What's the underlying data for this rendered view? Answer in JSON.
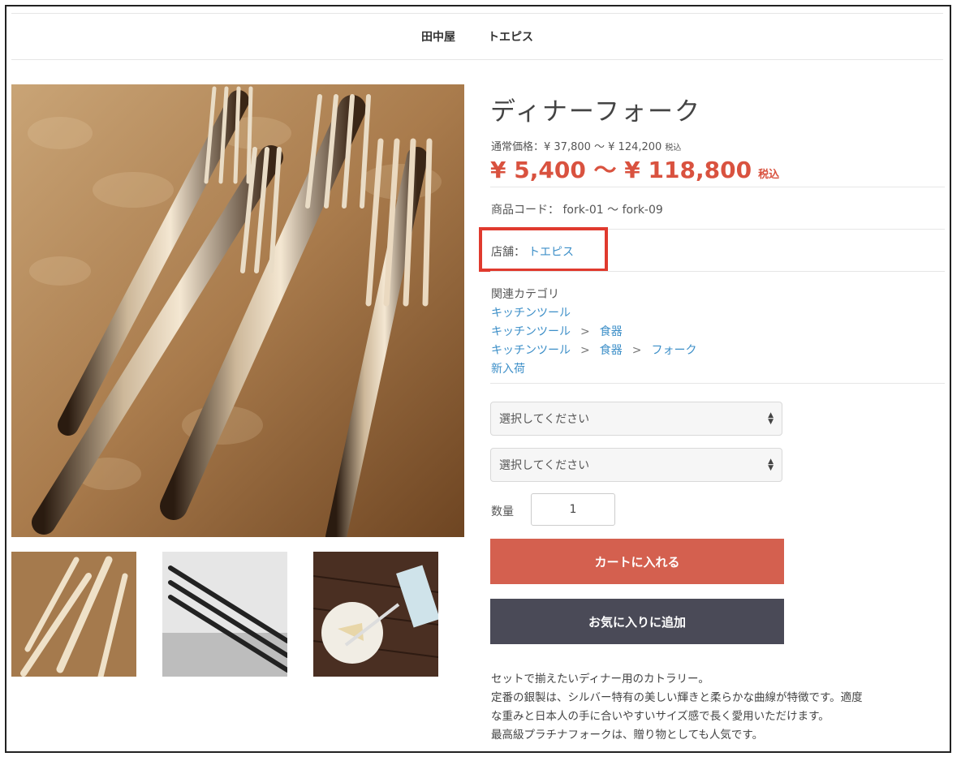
{
  "nav": {
    "links": [
      "田中屋",
      "トエピス"
    ]
  },
  "product": {
    "title": "ディナーフォーク",
    "regular_price_label": "通常価格：¥ 37,800 〜 ¥ 124,200",
    "regular_tax": "税込",
    "price": "¥ 5,400 〜 ¥ 118,800",
    "price_tax": "税込",
    "code_label": "商品コード：",
    "code_value": "fork-01 〜 fork-09",
    "store_label": "店舗：",
    "store_link": "トエピス"
  },
  "categories": {
    "heading": "関連カテゴリ",
    "line1": [
      "キッチンツール"
    ],
    "line2": [
      "キッチンツール",
      "食器"
    ],
    "line3": [
      "キッチンツール",
      "食器",
      "フォーク"
    ],
    "line4": [
      "新入荷"
    ],
    "separator": ">"
  },
  "options": {
    "select1": "選択してください",
    "select2": "選択してください"
  },
  "quantity": {
    "label": "数量",
    "value": "1"
  },
  "buttons": {
    "cart": "カートに入れる",
    "favorite": "お気に入りに追加"
  },
  "description": [
    "セットで揃えたいディナー用のカトラリー。",
    "定番の銀製は、シルバー特有の美しい輝きと柔らかな曲線が特徴です。適度",
    "な重みと日本人の手に合いやすいサイズ感で長く愛用いただけます。",
    "最高級プラチナフォークは、贈り物としても人気です。"
  ],
  "colors": {
    "accent_red": "#d9523f",
    "link_blue": "#3d8fc8",
    "highlight": "#e03a2e",
    "fav_button": "#4a4a57"
  }
}
